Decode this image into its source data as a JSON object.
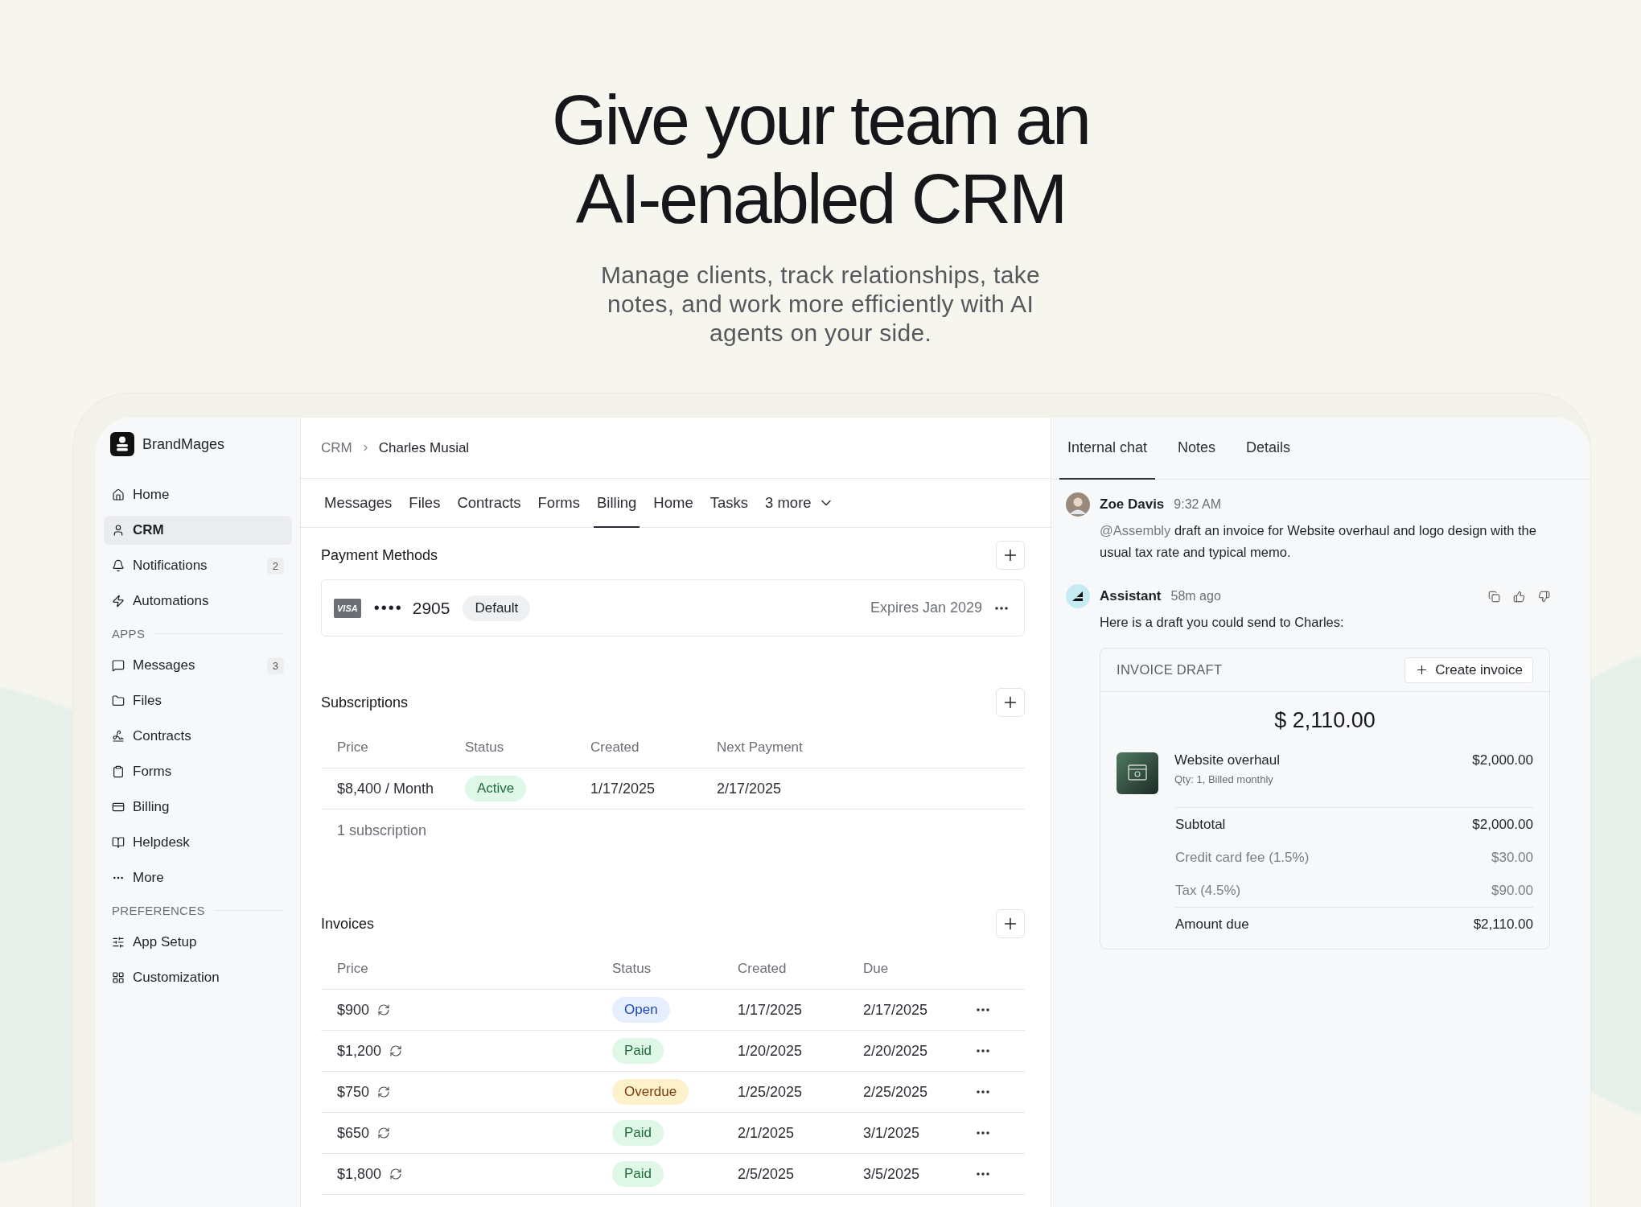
{
  "hero": {
    "title_lines": [
      "Give your team an",
      "AI‑enabled CRM"
    ],
    "subtitle": "Manage clients, track relationships, take notes, and work more efficiently with AI agents on your side."
  },
  "sidebar": {
    "brand": "BrandMages",
    "groups": [
      {
        "items": [
          {
            "label": "Home",
            "selected": false
          },
          {
            "label": "CRM",
            "selected": true
          },
          {
            "label": "Notifications",
            "badge": "2",
            "selected": false
          },
          {
            "label": "Automations",
            "selected": false
          }
        ]
      },
      {
        "heading": "APPS",
        "items": [
          {
            "label": "Messages",
            "badge": "3",
            "selected": false
          },
          {
            "label": "Files",
            "selected": false
          },
          {
            "label": "Contracts",
            "selected": false
          },
          {
            "label": "Forms",
            "selected": false
          },
          {
            "label": "Billing",
            "selected": false
          },
          {
            "label": "Helpdesk",
            "selected": false
          },
          {
            "label": "More",
            "selected": false
          }
        ]
      },
      {
        "heading": "PREFERENCES",
        "items": [
          {
            "label": "App Setup",
            "selected": false
          },
          {
            "label": "Customization",
            "selected": false
          }
        ]
      }
    ]
  },
  "breadcrumb": [
    "CRM",
    "Charles Musial"
  ],
  "tabs": [
    {
      "label": "Messages",
      "selected": false
    },
    {
      "label": "Files",
      "selected": false
    },
    {
      "label": "Contracts",
      "selected": false
    },
    {
      "label": "Forms",
      "selected": false
    },
    {
      "label": "Billing",
      "selected": true
    },
    {
      "label": "Home",
      "selected": false
    },
    {
      "label": "Tasks",
      "selected": false
    },
    {
      "label": "3 more",
      "kind": "menu",
      "selected": false
    }
  ],
  "payment_methods": {
    "title": "Payment Methods",
    "cards": [
      {
        "brand": "VISA",
        "mask": "••••",
        "last4": "2905",
        "badge": "Default",
        "expires": "Expires Jan 2029"
      }
    ]
  },
  "subscriptions": {
    "title": "Subscriptions",
    "columns": [
      "Price",
      "Status",
      "Created",
      "Next Payment"
    ],
    "rows": [
      {
        "price": "$8,400 / Month",
        "status": {
          "label": "Active",
          "kind": "active"
        },
        "created": "1/17/2025",
        "next": "2/17/2025"
      }
    ],
    "footer": "1 subscription"
  },
  "invoices": {
    "title": "Invoices",
    "columns": [
      "Price",
      "Status",
      "Created",
      "Due"
    ],
    "rows": [
      {
        "price": "$900",
        "recurring": true,
        "status": {
          "label": "Open",
          "kind": "open"
        },
        "created": "1/17/2025",
        "due": "2/17/2025"
      },
      {
        "price": "$1,200",
        "recurring": true,
        "status": {
          "label": "Paid",
          "kind": "paid"
        },
        "created": "1/20/2025",
        "due": "2/20/2025"
      },
      {
        "price": "$750",
        "recurring": true,
        "status": {
          "label": "Overdue",
          "kind": "overdue"
        },
        "created": "1/25/2025",
        "due": "2/25/2025"
      },
      {
        "price": "$650",
        "recurring": true,
        "status": {
          "label": "Paid",
          "kind": "paid"
        },
        "created": "2/1/2025",
        "due": "3/1/2025"
      },
      {
        "price": "$1,800",
        "recurring": true,
        "status": {
          "label": "Paid",
          "kind": "paid"
        },
        "created": "2/5/2025",
        "due": "3/5/2025"
      }
    ]
  },
  "panel": {
    "tabs": [
      {
        "label": "Internal chat",
        "selected": true
      },
      {
        "label": "Notes",
        "selected": false
      },
      {
        "label": "Details",
        "selected": false
      }
    ],
    "messages": [
      {
        "kind": "user",
        "author": "Zoe Davis",
        "time": "9:32 AM",
        "mention": "@Assembly",
        "text": "draft an invoice for Website overhaul and logo design with the usual tax rate and typical memo."
      },
      {
        "kind": "assistant",
        "author": "Assistant",
        "time": "58m ago",
        "text": "Here is a draft you could send to Charles:"
      }
    ],
    "invoice_draft": {
      "title": "INVOICE DRAFT",
      "button": "Create invoice",
      "total": "$ 2,110.00",
      "items": [
        {
          "name": "Website overhaul",
          "detail": "Qty: 1, Billed monthly",
          "amount": "$2,000.00"
        }
      ],
      "lines": [
        {
          "kind": "subtotal",
          "label": "Subtotal",
          "amount": "$2,000.00"
        },
        {
          "kind": "fee",
          "label": "Credit card fee (1.5%)",
          "amount": "$30.00"
        },
        {
          "kind": "fee",
          "label": "Tax (4.5%)",
          "amount": "$90.00"
        },
        {
          "kind": "total",
          "label": "Amount due",
          "amount": "$2,110.00"
        }
      ]
    }
  }
}
